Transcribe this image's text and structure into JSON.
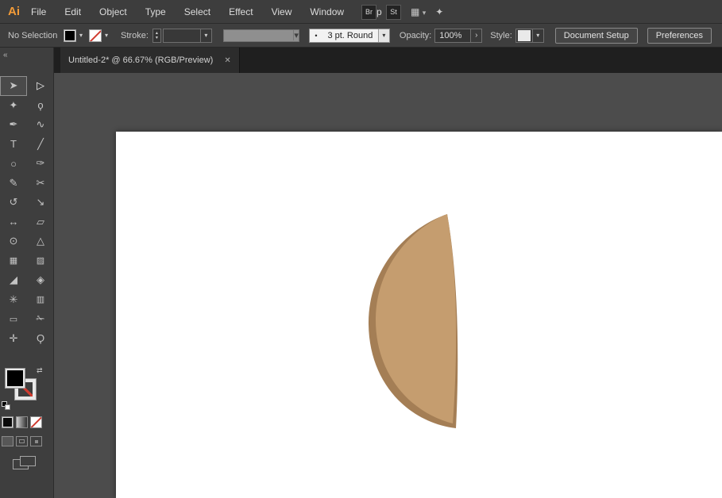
{
  "icons": {
    "chevron_down": "▾",
    "stepper_up": "▴",
    "stepper_down": "▾",
    "close": "✕",
    "collapse": "«",
    "swap": "⇄",
    "menu_grid": "▦",
    "share": "✦",
    "dot": "•",
    "arrow_right": "›"
  },
  "menu_bar": {
    "logo": "Ai",
    "items": [
      "File",
      "Edit",
      "Object",
      "Type",
      "Select",
      "Effect",
      "View",
      "Window",
      "Help"
    ],
    "bridge_badge": "Br",
    "stock_badge": "St"
  },
  "control_bar": {
    "status": "No Selection",
    "stroke_label": "Stroke:",
    "brush_name": "3 pt. Round",
    "opacity_label": "Opacity:",
    "opacity_value": "100%",
    "style_label": "Style:",
    "document_setup": "Document Setup",
    "preferences": "Preferences"
  },
  "tab": {
    "title": "Untitled-2* @ 66.67% (RGB/Preview)"
  },
  "tools": [
    {
      "name": "selection-tool",
      "glyph": "➤"
    },
    {
      "name": "direct-selection-tool",
      "glyph": "▷"
    },
    {
      "name": "magic-wand-tool",
      "glyph": "✦"
    },
    {
      "name": "lasso-tool",
      "glyph": "ϙ"
    },
    {
      "name": "pen-tool",
      "glyph": "✒"
    },
    {
      "name": "curvature-tool",
      "glyph": "∿"
    },
    {
      "name": "type-tool",
      "glyph": "T"
    },
    {
      "name": "line-segment-tool",
      "glyph": "╱"
    },
    {
      "name": "ellipse-tool",
      "glyph": "○"
    },
    {
      "name": "paintbrush-tool",
      "glyph": "✑"
    },
    {
      "name": "shaper-tool",
      "glyph": "✎"
    },
    {
      "name": "scissors-tool",
      "glyph": "✂"
    },
    {
      "name": "rotate-tool",
      "glyph": "↺"
    },
    {
      "name": "scale-tool",
      "glyph": "↘"
    },
    {
      "name": "width-tool",
      "glyph": "↔"
    },
    {
      "name": "free-transform-tool",
      "glyph": "▱"
    },
    {
      "name": "shape-builder-tool",
      "glyph": "⊙"
    },
    {
      "name": "perspective-grid-tool",
      "glyph": "△"
    },
    {
      "name": "mesh-tool",
      "glyph": "▦"
    },
    {
      "name": "gradient-tool",
      "glyph": "▨"
    },
    {
      "name": "eyedropper-tool",
      "glyph": "◢"
    },
    {
      "name": "blend-tool",
      "glyph": "◈"
    },
    {
      "name": "symbol-sprayer-tool",
      "glyph": "✳"
    },
    {
      "name": "column-graph-tool",
      "glyph": "▥"
    },
    {
      "name": "artboard-tool",
      "glyph": "▭"
    },
    {
      "name": "slice-tool",
      "glyph": "✁"
    },
    {
      "name": "hand-tool",
      "glyph": "✛"
    },
    {
      "name": "zoom-tool",
      "glyph": "Ϙ"
    }
  ],
  "shape": {
    "light": "#c59d6f",
    "dark": "#a47e55"
  },
  "colors": {
    "fill_swatch": "#000000",
    "none_slash": "#d03b2f",
    "logo_orange": "#f29b38",
    "artboard": "#ffffff",
    "pasteboard": "#4c4c4c"
  }
}
